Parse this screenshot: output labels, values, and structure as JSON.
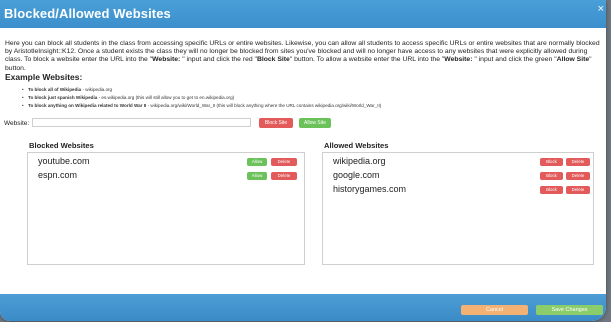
{
  "dialog": {
    "title": "Blocked/Allowed Websites",
    "close_glyph": "×"
  },
  "intro": {
    "p1": "Here you can block all students in the class from accessing specific URLs or entire websites. Likewise, you can allow all students to access specific URLs or entire websites that are normally blocked by AristotleInsight::K12. Once a student exists the class they will no longer be blocked from sites you've blocked and will no longer have access to any websites that were explicitly allowed during class. To block a website enter the URL into the \"",
    "website_bold_1": "Website:",
    "p2": " \" input and click the red \"",
    "block_site_bold": "Block Site",
    "p3": "\" button. To allow a website enter the URL into the \"",
    "website_bold_2": "Website:",
    "p4": " \" input and click the green \"",
    "allow_site_bold": "Allow Site",
    "p5": "\" button."
  },
  "examples": {
    "title": "Example Websites:",
    "items": [
      {
        "bold": "To block all of Wikipedia",
        "rest": " - wikipedia.org"
      },
      {
        "bold": "To block just spanish Wikipedia",
        "rest": " - es.wikipedia.org (this will still allow you to get to en.wikipedia.org)"
      },
      {
        "bold": "To block anything on Wikipedia related to World War II",
        "rest": " - wikipedia.org/wiki/World_War_II (this will block anything where the URL contains wikipedia.org/wiki/World_War_II)"
      }
    ]
  },
  "website_form": {
    "label": "Website:",
    "value": "",
    "block_button": "Block Site",
    "allow_button": "Allow Site"
  },
  "blocked": {
    "heading": "Blocked Websites",
    "allow_label": "Allow",
    "delete_label": "Delete",
    "items": [
      "youtube.com",
      "espn.com"
    ]
  },
  "allowed": {
    "heading": "Allowed Websites",
    "block_label": "Block",
    "delete_label": "Delete",
    "items": [
      "wikipedia.org",
      "google.com",
      "historygames.com"
    ]
  },
  "footer": {
    "cancel": "Cancel",
    "save": "Save Changes"
  },
  "colors": {
    "header_blue": "#3b8fcc",
    "red": "#e25a5a",
    "green": "#6cc25a",
    "cancel_orange": "#f3b273",
    "save_green": "#8ccd6b"
  }
}
